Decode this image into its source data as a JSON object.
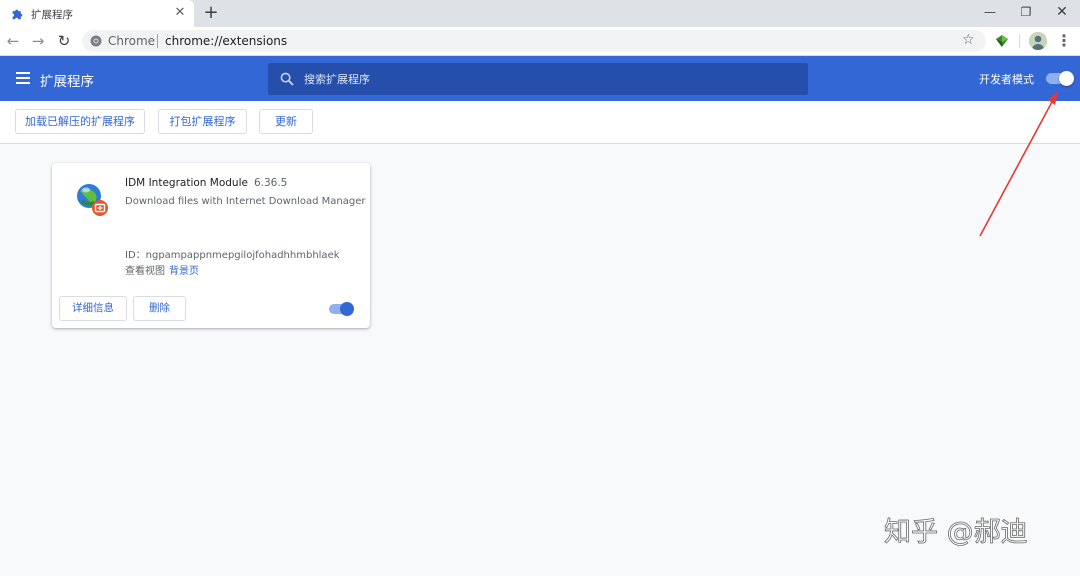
{
  "browser": {
    "tab": {
      "title": "扩展程序",
      "icon": "puzzle-icon"
    },
    "new_tab_label": "+",
    "window_controls": {
      "minimize": "—",
      "maximize": "❐",
      "close": "✕"
    },
    "toolbar": {
      "back": "←",
      "forward": "→",
      "reload": "↻",
      "site_name": "Chrome",
      "url": "chrome://extensions",
      "star": "☆",
      "menu": "⋮"
    }
  },
  "header": {
    "title": "扩展程序",
    "search_placeholder": "搜索扩展程序",
    "developer_mode_label": "开发者模式",
    "developer_mode_on": true,
    "accent_color": "#3367d6"
  },
  "dev_bar": {
    "load_unpacked": "加载已解压的扩展程序",
    "pack": "打包扩展程序",
    "update": "更新"
  },
  "extension": {
    "name": "IDM Integration Module",
    "version": "6.36.5",
    "description": "Download files with Internet Download Manager",
    "id_line": "ID：ngpampappnmepgilojfohadhhmbhlaek",
    "inspect_views_label": "查看视图",
    "background_page_link": "背景页",
    "details_button": "详细信息",
    "remove_button": "删除",
    "enabled": true
  },
  "annotation": {
    "arrow_color": "#e53935"
  },
  "watermark": "知乎 @郝迪"
}
